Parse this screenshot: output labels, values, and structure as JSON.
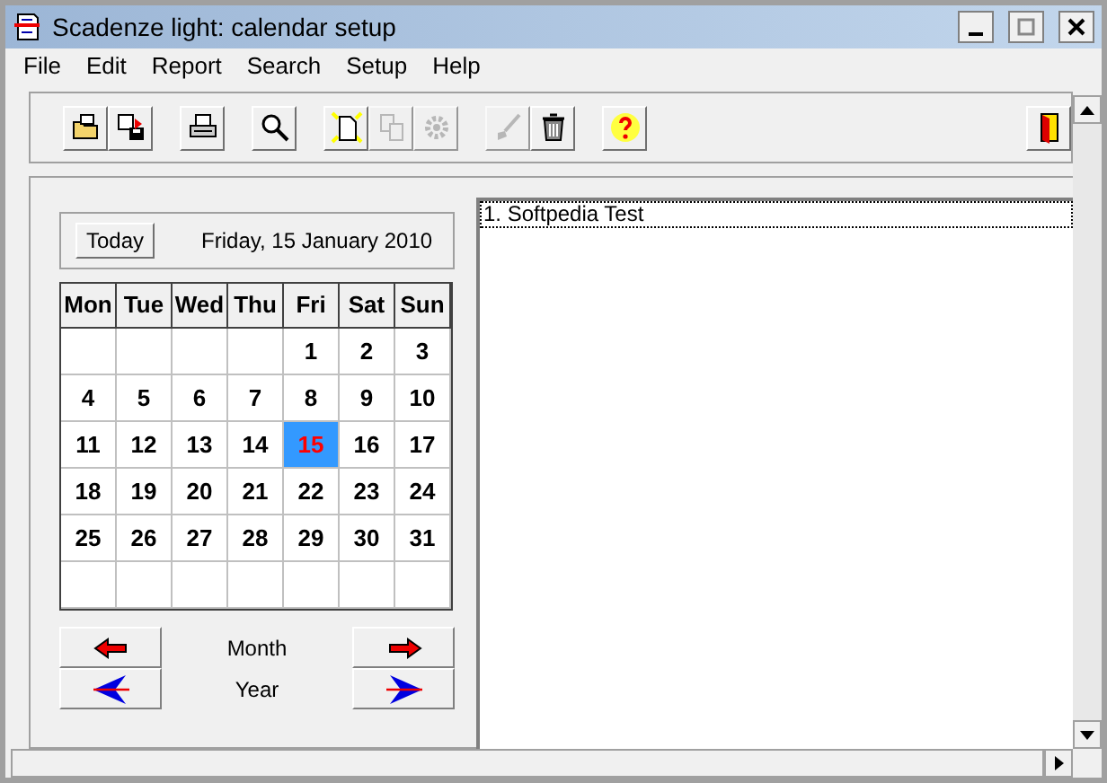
{
  "window": {
    "title": "Scadenze light: calendar setup"
  },
  "menu": [
    "File",
    "Edit",
    "Report",
    "Search",
    "Setup",
    "Help"
  ],
  "toolbar": {
    "groups": [
      [
        {
          "kind": "open",
          "disabled": false
        },
        {
          "kind": "import",
          "disabled": false
        }
      ],
      [
        {
          "kind": "print",
          "disabled": false
        }
      ],
      [
        {
          "kind": "search",
          "disabled": false
        }
      ],
      [
        {
          "kind": "new",
          "disabled": false
        },
        {
          "kind": "copy",
          "disabled": true
        },
        {
          "kind": "settings",
          "disabled": true
        }
      ],
      [
        {
          "kind": "brush",
          "disabled": true
        },
        {
          "kind": "delete",
          "disabled": false
        }
      ],
      [
        {
          "kind": "help",
          "disabled": false
        }
      ]
    ],
    "exit": {
      "kind": "exit",
      "disabled": false
    }
  },
  "calendar": {
    "today_button": "Today",
    "date": "Friday, 15 January 2010",
    "weekdays": [
      "Mon",
      "Tue",
      "Wed",
      "Thu",
      "Fri",
      "Sat",
      "Sun"
    ],
    "weeks": [
      [
        {
          "kind": "blank"
        },
        {
          "kind": "blank"
        },
        {
          "kind": "blank"
        },
        {
          "kind": "blank"
        },
        {
          "day": "1",
          "selected": false
        },
        {
          "day": "2",
          "selected": false
        },
        {
          "day": "3",
          "selected": false
        }
      ],
      [
        {
          "day": "4",
          "selected": false
        },
        {
          "day": "5",
          "selected": false
        },
        {
          "day": "6",
          "selected": false
        },
        {
          "day": "7",
          "selected": false
        },
        {
          "day": "8",
          "selected": false
        },
        {
          "day": "9",
          "selected": false
        },
        {
          "day": "10",
          "selected": false
        }
      ],
      [
        {
          "day": "11",
          "selected": false
        },
        {
          "day": "12",
          "selected": false
        },
        {
          "day": "13",
          "selected": false
        },
        {
          "day": "14",
          "selected": false
        },
        {
          "day": "15",
          "selected": true
        },
        {
          "day": "16",
          "selected": false
        },
        {
          "day": "17",
          "selected": false
        }
      ],
      [
        {
          "day": "18",
          "selected": false
        },
        {
          "day": "19",
          "selected": false
        },
        {
          "day": "20",
          "selected": false
        },
        {
          "day": "21",
          "selected": false
        },
        {
          "day": "22",
          "selected": false
        },
        {
          "day": "23",
          "selected": false
        },
        {
          "day": "24",
          "selected": false
        }
      ],
      [
        {
          "day": "25",
          "selected": false
        },
        {
          "day": "26",
          "selected": false
        },
        {
          "day": "27",
          "selected": false
        },
        {
          "day": "28",
          "selected": false
        },
        {
          "day": "29",
          "selected": false
        },
        {
          "day": "30",
          "selected": false
        },
        {
          "day": "31",
          "selected": false
        }
      ],
      [
        {
          "kind": "blank"
        },
        {
          "kind": "blank"
        },
        {
          "kind": "blank"
        },
        {
          "kind": "blank"
        },
        {
          "kind": "blank"
        },
        {
          "kind": "blank"
        },
        {
          "kind": "blank"
        }
      ]
    ],
    "navigation": [
      {
        "label": "Month",
        "kind": "month"
      },
      {
        "label": "Year",
        "kind": "year"
      }
    ]
  },
  "list": {
    "items": [
      {
        "text": "1. Softpedia Test",
        "selected": true
      }
    ]
  }
}
